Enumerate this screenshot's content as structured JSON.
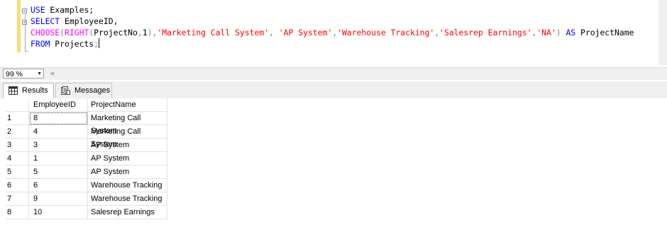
{
  "editor": {
    "lines": [
      [
        {
          "t": "USE",
          "c": "kw"
        },
        {
          "t": " Examples;",
          "c": ""
        }
      ],
      [
        {
          "t": "SELECT",
          "c": "kw"
        },
        {
          "t": " EmployeeID,",
          "c": ""
        }
      ],
      [
        {
          "t": "CHOOSE",
          "c": "fn"
        },
        {
          "t": "(",
          "c": "gr"
        },
        {
          "t": "RIGHT",
          "c": "fn"
        },
        {
          "t": "(",
          "c": "gr"
        },
        {
          "t": "ProjectNo",
          "c": ""
        },
        {
          "t": ",",
          "c": "gr"
        },
        {
          "t": "1",
          "c": ""
        },
        {
          "t": "),",
          "c": "gr"
        },
        {
          "t": "'Marketing Call System'",
          "c": "str"
        },
        {
          "t": ",",
          "c": "gr"
        },
        {
          "t": " ",
          "c": ""
        },
        {
          "t": "'AP System'",
          "c": "str"
        },
        {
          "t": ",",
          "c": "gr"
        },
        {
          "t": "'Warehouse Tracking'",
          "c": "str"
        },
        {
          "t": ",",
          "c": "gr"
        },
        {
          "t": "'Salesrep Earnings'",
          "c": "str"
        },
        {
          "t": ",",
          "c": "gr"
        },
        {
          "t": "'NA'",
          "c": "str"
        },
        {
          "t": ")",
          "c": "gr"
        },
        {
          "t": " ",
          "c": ""
        },
        {
          "t": "AS",
          "c": "kw"
        },
        {
          "t": " ProjectName",
          "c": ""
        }
      ],
      [
        {
          "t": "FROM",
          "c": "kw"
        },
        {
          "t": " Projects",
          "c": ""
        },
        {
          "t": ";",
          "c": "gr"
        }
      ]
    ]
  },
  "zoom": {
    "value": "99 %"
  },
  "tabs": {
    "results": "Results",
    "messages": "Messages"
  },
  "grid": {
    "headers": [
      "",
      "EmployeeID",
      "ProjectName"
    ],
    "rows": [
      [
        "1",
        "8",
        "Marketing Call System"
      ],
      [
        "2",
        "4",
        "Marketing Call System"
      ],
      [
        "3",
        "3",
        "AP System"
      ],
      [
        "4",
        "1",
        "AP System"
      ],
      [
        "5",
        "5",
        "AP System"
      ],
      [
        "6",
        "6",
        "Warehouse Tracking"
      ],
      [
        "7",
        "9",
        "Warehouse Tracking"
      ],
      [
        "8",
        "10",
        "Salesrep Earnings"
      ]
    ]
  },
  "icons": {
    "results_tab": "grid-icon",
    "messages_tab": "messages-icon",
    "fold": "collapse-icon"
  },
  "colors": {
    "keyword": "#0000ff",
    "function": "#ff00ff",
    "string": "#ff0000",
    "punctuation": "#808080",
    "change_bar": "#f7dd7a"
  }
}
